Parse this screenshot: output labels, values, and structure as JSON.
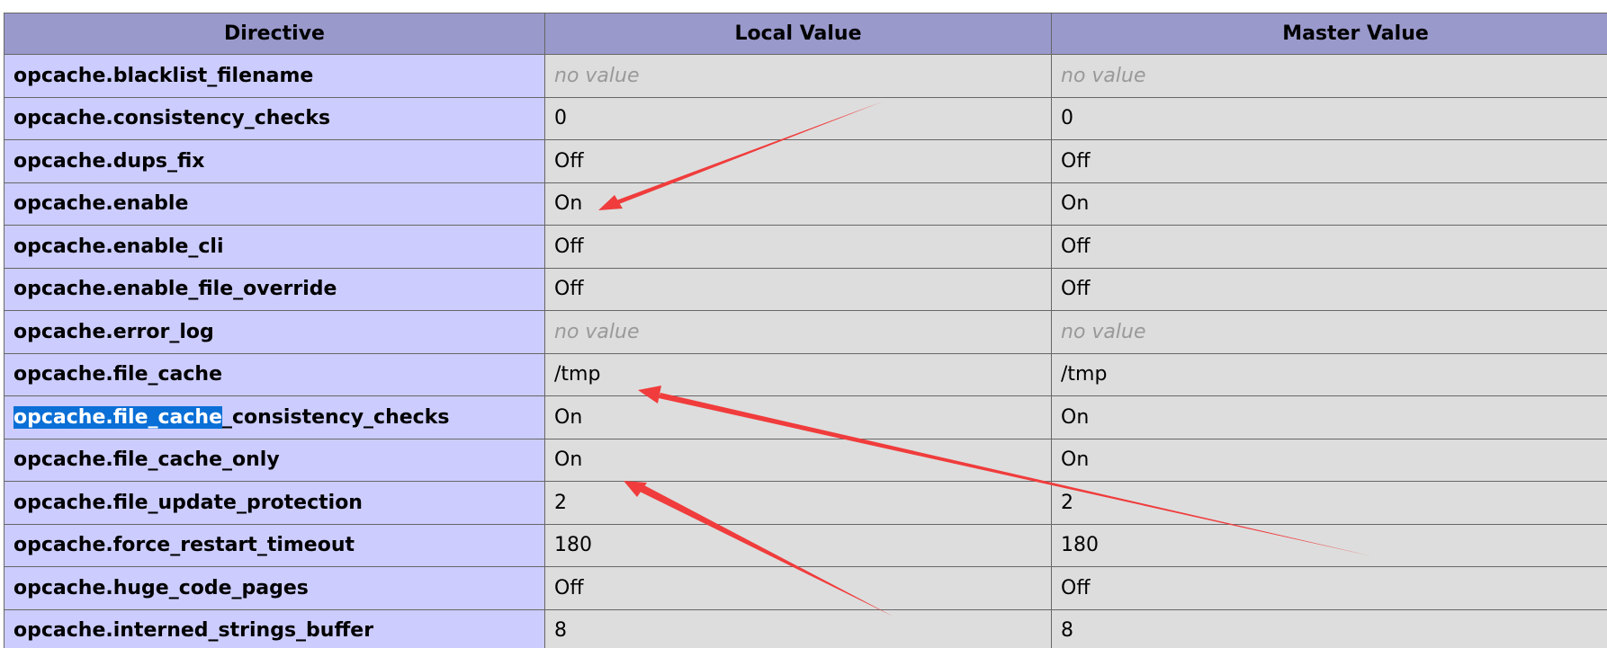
{
  "table": {
    "headers": [
      "Directive",
      "Local Value",
      "Master Value"
    ],
    "rows": [
      {
        "directive": "opcache.blacklist_filename",
        "local": "no value",
        "master": "no value",
        "no_value": true
      },
      {
        "directive": "opcache.consistency_checks",
        "local": "0",
        "master": "0"
      },
      {
        "directive": "opcache.dups_fix",
        "local": "Off",
        "master": "Off"
      },
      {
        "directive": "opcache.enable",
        "local": "On",
        "master": "On"
      },
      {
        "directive": "opcache.enable_cli",
        "local": "Off",
        "master": "Off"
      },
      {
        "directive": "opcache.enable_file_override",
        "local": "Off",
        "master": "Off"
      },
      {
        "directive": "opcache.error_log",
        "local": "no value",
        "master": "no value",
        "no_value": true
      },
      {
        "directive": "opcache.file_cache",
        "local": "/tmp",
        "master": "/tmp"
      },
      {
        "directive": "opcache.file_cache_consistency_checks",
        "directive_selected": "opcache.file_cache",
        "directive_rest": "_consistency_checks",
        "local": "On",
        "master": "On"
      },
      {
        "directive": "opcache.file_cache_only",
        "local": "On",
        "master": "On"
      },
      {
        "directive": "opcache.file_update_protection",
        "local": "2",
        "master": "2"
      },
      {
        "directive": "opcache.force_restart_timeout",
        "local": "180",
        "master": "180"
      },
      {
        "directive": "opcache.huge_code_pages",
        "local": "Off",
        "master": "Off"
      },
      {
        "directive": "opcache.interned_strings_buffer",
        "local": "8",
        "master": "8"
      }
    ]
  },
  "colors": {
    "header_bg": "#9999cc",
    "directive_bg": "#ccccff",
    "value_bg": "#dddddd",
    "border": "#666666",
    "no_value_text": "#999999",
    "selection_bg": "#0a6fd6",
    "annotation_arrow": "#f03c3c"
  },
  "annotations": [
    {
      "type": "arrow",
      "icon": "red-arrow-icon",
      "points_to": "opcache.enable local value"
    },
    {
      "type": "arrow",
      "icon": "red-arrow-icon",
      "points_to": "opcache.file_cache local value"
    },
    {
      "type": "arrow",
      "icon": "red-arrow-icon",
      "points_to": "opcache.file_cache_only local value"
    }
  ]
}
